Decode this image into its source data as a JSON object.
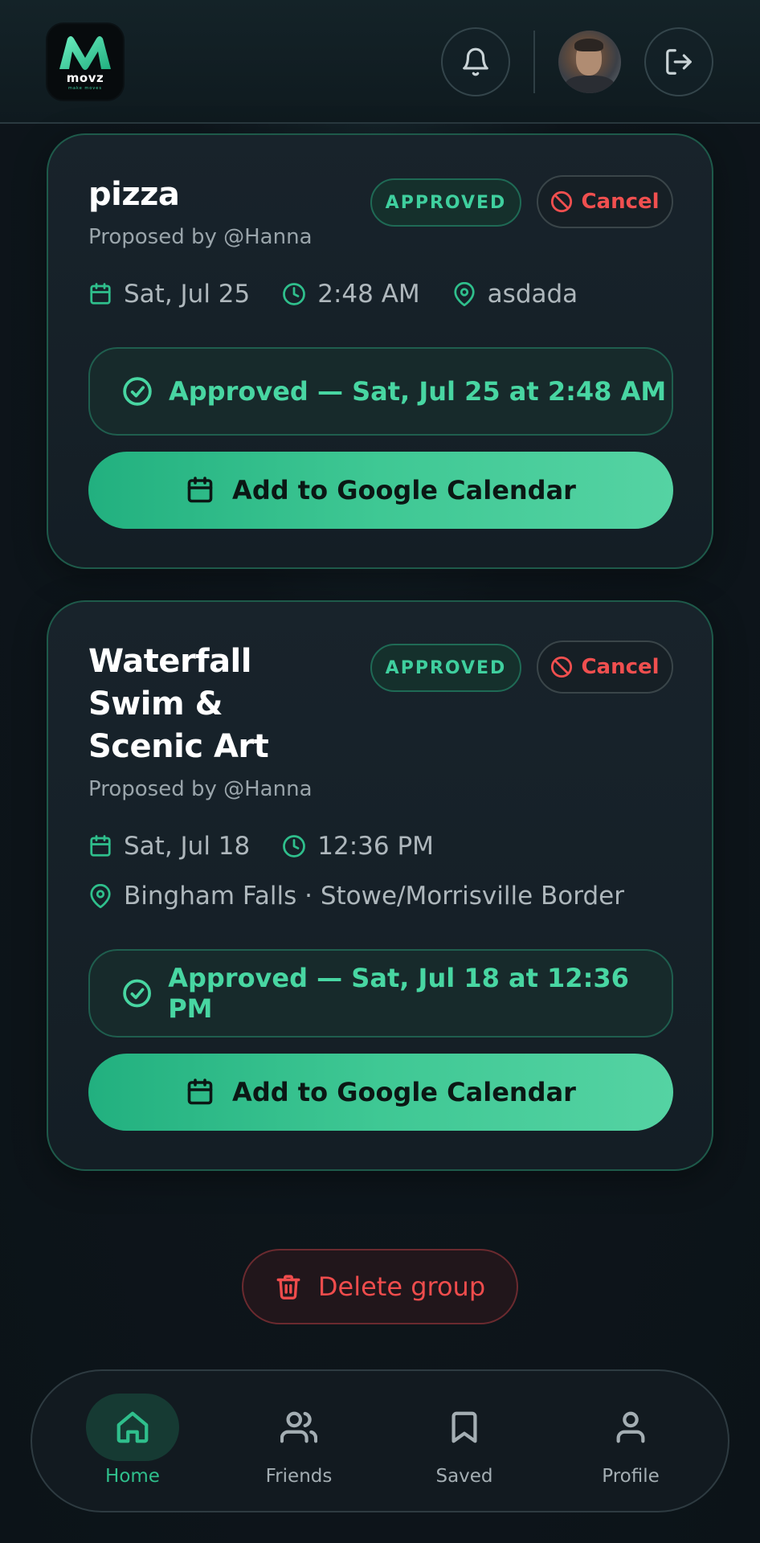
{
  "app": {
    "logo_text": "movz",
    "logo_tagline": "make moves"
  },
  "header": {
    "notifications_icon": "bell-icon",
    "logout_icon": "logout-icon",
    "avatar": "user-avatar"
  },
  "events": [
    {
      "title": "pizza",
      "proposed_by": "Proposed by @Hanna",
      "status": "APPROVED",
      "cancel_label": "Cancel",
      "date": "Sat, Jul 25",
      "time": "2:48 AM",
      "location": "asdada",
      "approved_text": "Approved — Sat, Jul 25 at 2:48 AM",
      "calendar_button": "Add to Google Calendar"
    },
    {
      "title_lines": [
        "Waterfall",
        "Swim &",
        "Scenic Art"
      ],
      "proposed_by": "Proposed by @Hanna",
      "status": "APPROVED",
      "cancel_label": "Cancel",
      "date": "Sat, Jul 18",
      "time": "12:36 PM",
      "location": "Bingham Falls · Stowe/Morrisville Border",
      "approved_text": "Approved — Sat, Jul 18 at 12:36 PM",
      "calendar_button": "Add to Google Calendar"
    }
  ],
  "delete_group_label": "Delete group",
  "nav": {
    "items": [
      {
        "label": "Home",
        "icon": "home-icon",
        "active": true
      },
      {
        "label": "Friends",
        "icon": "friends-icon",
        "active": false
      },
      {
        "label": "Saved",
        "icon": "bookmark-icon",
        "active": false
      },
      {
        "label": "Profile",
        "icon": "profile-icon",
        "active": false
      }
    ]
  },
  "colors": {
    "accent": "#2fbf8c",
    "danger": "#ef4c4c",
    "background": "#0d141a",
    "card_border": "#1e5a4a"
  }
}
